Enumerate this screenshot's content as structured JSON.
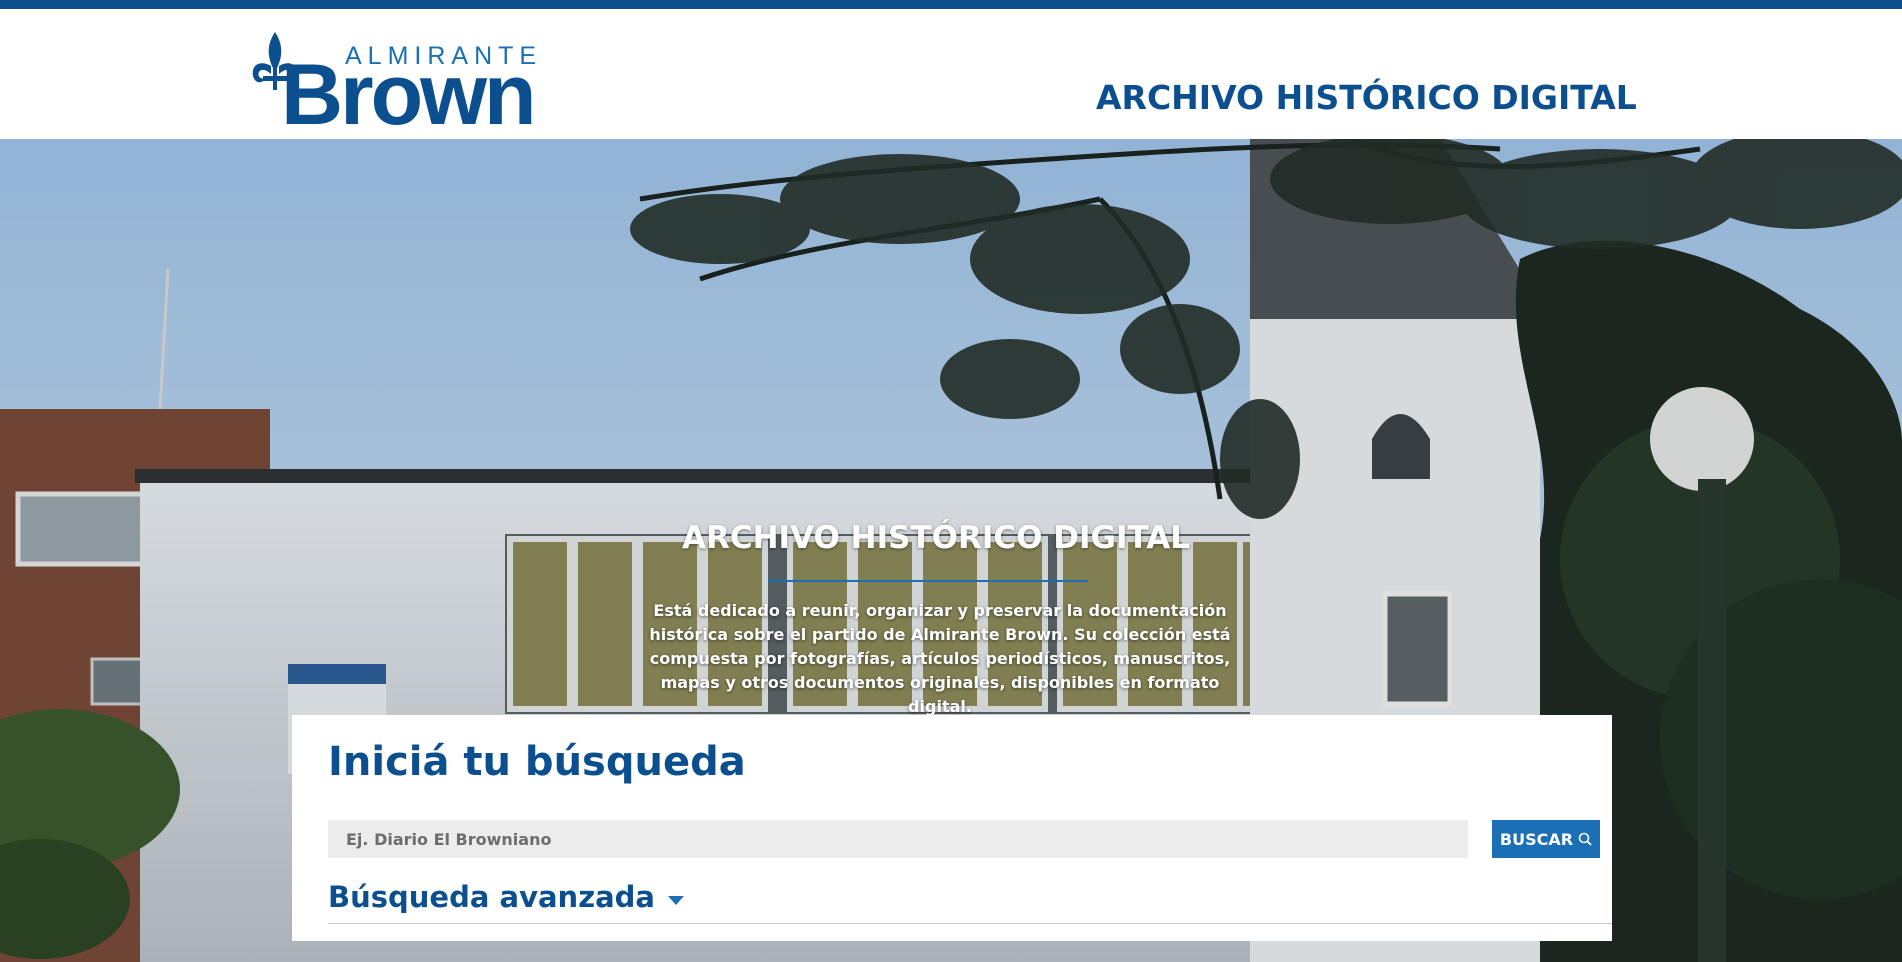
{
  "colors": {
    "brand_dark": "#0b4f8f",
    "brand_accent": "#1a6fb5",
    "input_bg": "#ececec"
  },
  "logo": {
    "top_text": "ALMIRANTE",
    "main_text": "Brown",
    "icon": "fleur-de-lis-icon"
  },
  "header": {
    "title": "ARCHIVO HISTÓRICO DIGITAL"
  },
  "hero": {
    "title": "ARCHIVO HISTÓRICO DIGITAL",
    "description": "Está dedicado a reunir, organizar y preservar la documentación histórica sobre el partido de Almirante Brown. Su colección está compuesta por fotografías, artículos periodísticos, manuscritos, mapas y otros documentos originales, disponibles en formato digital."
  },
  "search": {
    "heading": "Iniciá tu búsqueda",
    "placeholder": "Ej. Diario El Browniano",
    "value": "",
    "button_label": "BUSCAR",
    "button_icon": "search-icon",
    "advanced_label": "Búsqueda avanzada",
    "advanced_icon": "caret-down-icon"
  }
}
